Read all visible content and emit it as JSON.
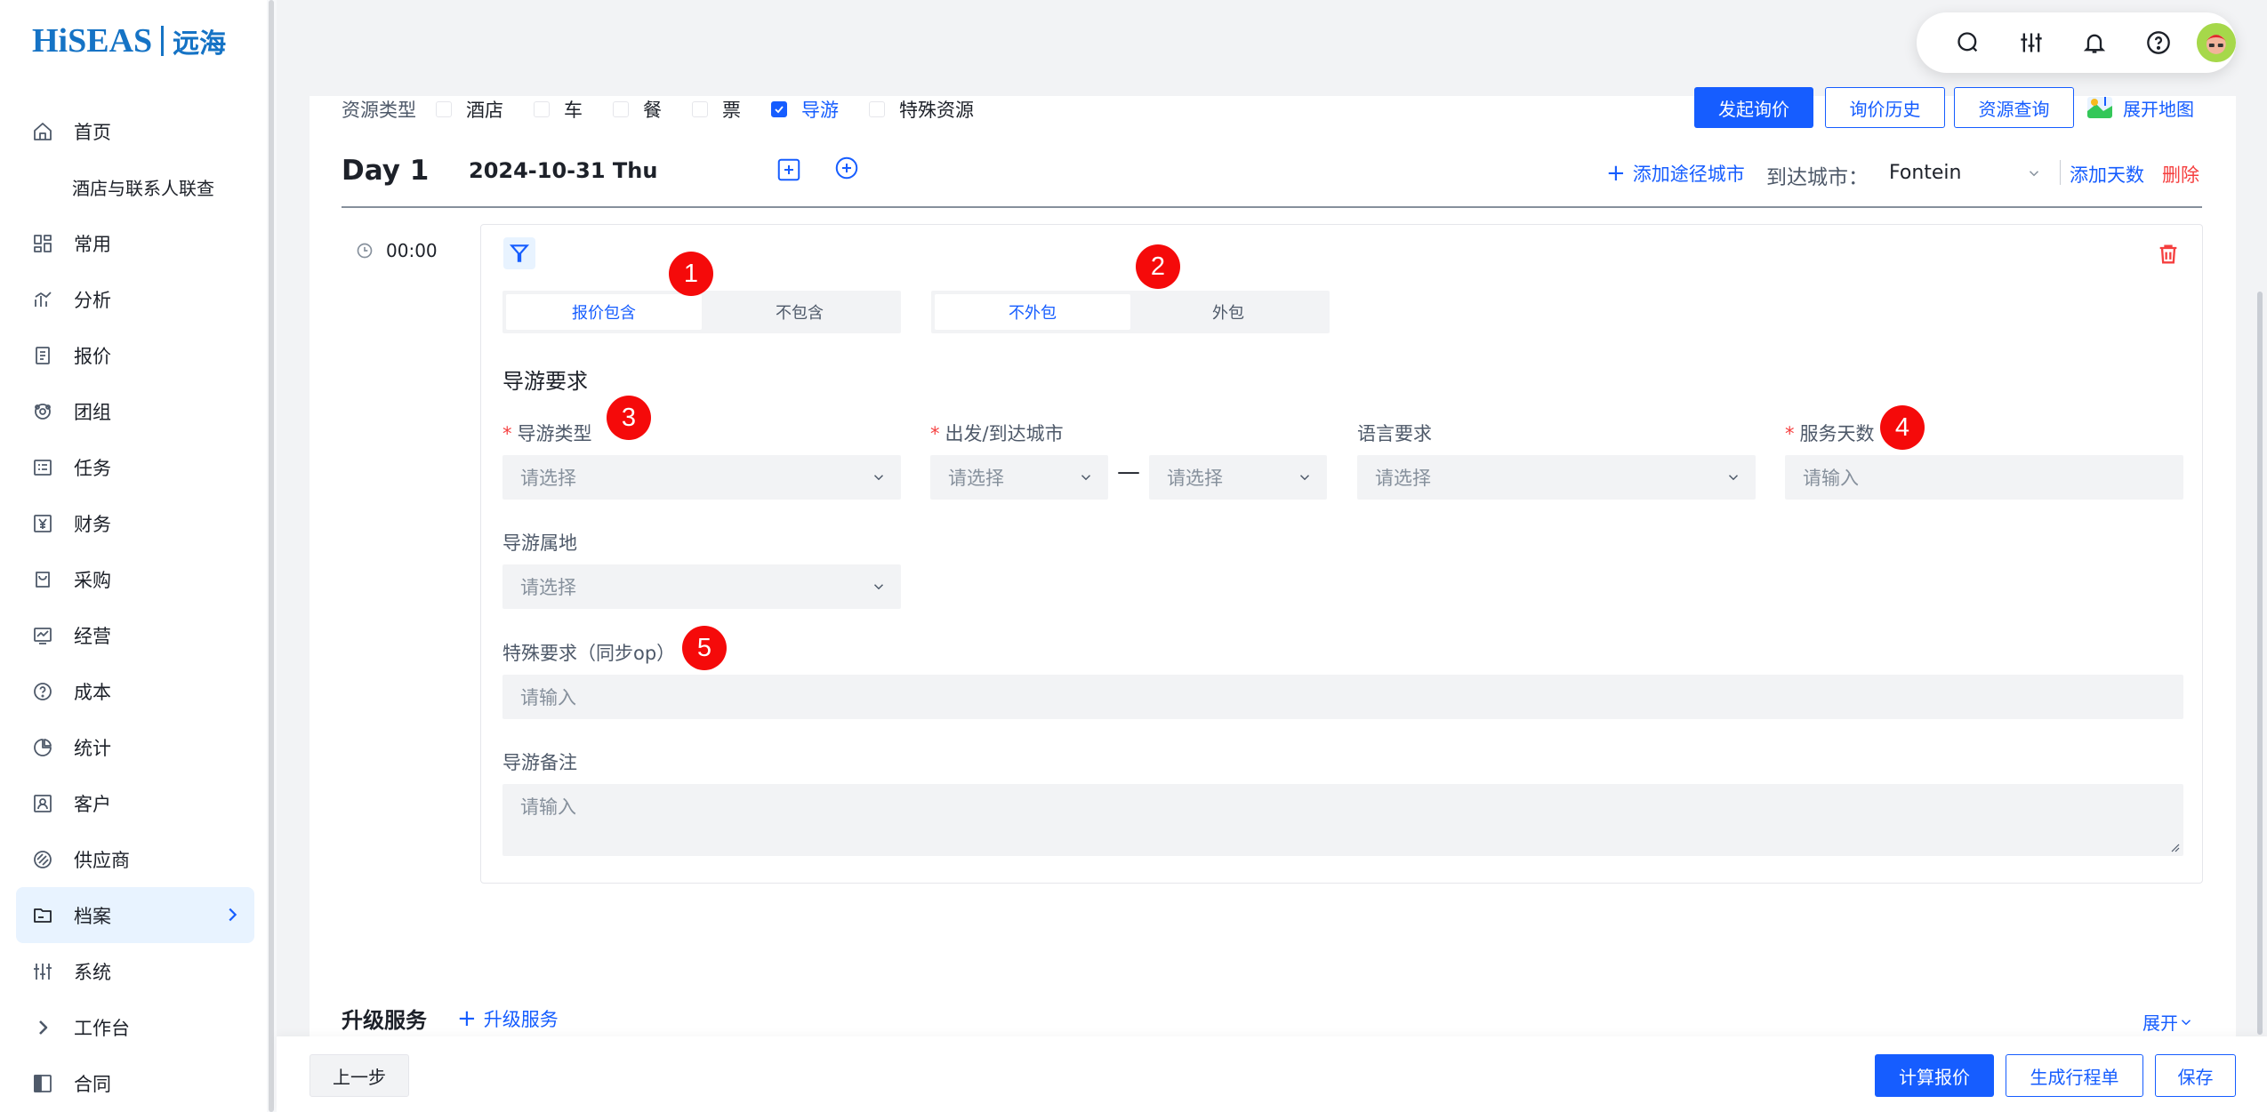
{
  "brand": {
    "logo_text": "HiSEAS",
    "logo_cn": "远海"
  },
  "sidebar": {
    "items": [
      {
        "label": "首页",
        "icon": "home-icon"
      },
      {
        "label": "酒店与联系人联查",
        "icon": ""
      },
      {
        "label": "常用",
        "icon": "dashboard-icon"
      },
      {
        "label": "分析",
        "icon": "analysis-icon"
      },
      {
        "label": "报价",
        "icon": "quote-icon"
      },
      {
        "label": "团组",
        "icon": "group-icon"
      },
      {
        "label": "任务",
        "icon": "task-icon"
      },
      {
        "label": "财务",
        "icon": "finance-icon"
      },
      {
        "label": "采购",
        "icon": "purchase-icon"
      },
      {
        "label": "经营",
        "icon": "operation-icon"
      },
      {
        "label": "成本",
        "icon": "cost-icon"
      },
      {
        "label": "统计",
        "icon": "pie-chart-icon"
      },
      {
        "label": "客户",
        "icon": "customer-icon"
      },
      {
        "label": "供应商",
        "icon": "supplier-icon"
      },
      {
        "label": "档案",
        "icon": "archive-icon",
        "active": true
      },
      {
        "label": "系统",
        "icon": "settings-sliders-icon"
      },
      {
        "label": "工作台",
        "icon": "chevron-right-icon"
      },
      {
        "label": "合同",
        "icon": "contract-icon"
      }
    ]
  },
  "toolbar": {
    "icons": [
      "search-icon",
      "sliders-icon",
      "bell-icon",
      "help-icon",
      "avatar"
    ]
  },
  "resource": {
    "label": "资源类型",
    "types": [
      {
        "label": "酒店",
        "checked": false
      },
      {
        "label": "车",
        "checked": false
      },
      {
        "label": "餐",
        "checked": false
      },
      {
        "label": "票",
        "checked": false
      },
      {
        "label": "导游",
        "checked": true
      },
      {
        "label": "特殊资源",
        "checked": false
      }
    ]
  },
  "actions": {
    "inquiry": "发起询价",
    "history": "询价历史",
    "resource_query": "资源查询",
    "map": "展开地图"
  },
  "day": {
    "title": "Day 1",
    "date": "2024-10-31 Thu",
    "add_city": "添加途径城市",
    "arrive_label": "到达城市：",
    "arrive_value": "Fontein",
    "add_days": "添加天数",
    "delete": "删除",
    "time": "00:00"
  },
  "guide": {
    "seg1": [
      "报价包含",
      "不包含"
    ],
    "seg2": [
      "不外包",
      "外包"
    ],
    "section_title": "导游要求",
    "guide_type_label": "导游类型",
    "city_label": "出发/到达城市",
    "language_label": "语言要求",
    "service_days_label": "服务天数",
    "origin_label": "导游属地",
    "special_label": "特殊要求（同步op）",
    "remark_label": "导游备注",
    "select_ph": "请选择",
    "input_ph": "请输入",
    "badges": [
      "1",
      "2",
      "3",
      "4",
      "5"
    ]
  },
  "upgrade": {
    "title": "升级服务",
    "add": "升级服务",
    "expand": "展开"
  },
  "footer": {
    "prev": "上一步",
    "calc": "计算报价",
    "gen": "生成行程单",
    "save": "保存"
  },
  "colors": {
    "primary": "#165dff",
    "danger": "#f53f3f",
    "badge": "#f50a0a"
  }
}
